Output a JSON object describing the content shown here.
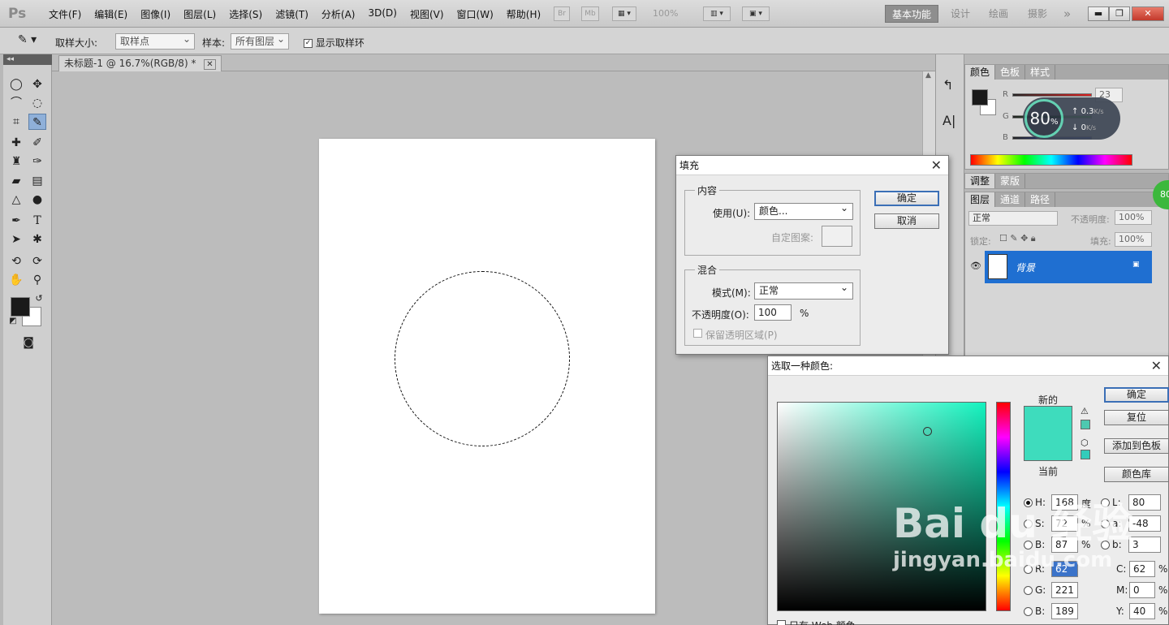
{
  "app": {
    "logo": "Ps",
    "menu": [
      "文件(F)",
      "编辑(E)",
      "图像(I)",
      "图层(L)",
      "选择(S)",
      "滤镜(T)",
      "分析(A)",
      "3D(D)",
      "视图(V)",
      "窗口(W)",
      "帮助(H)"
    ],
    "zoom": "100%",
    "bridge": "Br",
    "minibridge": "Mb",
    "workspaces": [
      "基本功能",
      "设计",
      "绘画",
      "摄影"
    ],
    "more": "»"
  },
  "options_bar": {
    "sample_size_label": "取样大小:",
    "sample_size_value": "取样点",
    "sample_label": "样本:",
    "sample_value": "所有图层",
    "show_ring_label": "显示取样环"
  },
  "document": {
    "tab_title": "未标题-1 @ 16.7%(RGB/8) *"
  },
  "color_panel": {
    "tabs": [
      "颜色",
      "色板",
      "样式"
    ],
    "r_label": "R",
    "g_label": "G",
    "b_label": "B",
    "r_value": "23"
  },
  "net_widget": {
    "percent": "80",
    "percent_sign": "%",
    "up": "0.3",
    "down": "0",
    "unit": "K/s"
  },
  "adjust_panel": {
    "tabs": [
      "调整",
      "蒙版"
    ]
  },
  "layers_panel": {
    "tabs": [
      "图层",
      "通道",
      "路径"
    ],
    "blend_mode": "正常",
    "opacity_label": "不透明度:",
    "opacity_value": "100%",
    "lock_label": "锁定:",
    "fill_label": "填充:",
    "fill_value": "100%",
    "layer_name": "背景"
  },
  "side_badge": "80",
  "fill_dialog": {
    "title": "填充",
    "content_group": "内容",
    "use_label": "使用(U):",
    "use_value": "颜色...",
    "custom_pattern_label": "自定图案:",
    "blend_group": "混合",
    "mode_label": "模式(M):",
    "mode_value": "正常",
    "opacity_label": "不透明度(O):",
    "opacity_value": "100",
    "percent": "%",
    "preserve_label": "保留透明区域(P)",
    "ok": "确定",
    "cancel": "取消"
  },
  "color_picker": {
    "title": "选取一种颜色:",
    "new_label": "新的",
    "current_label": "当前",
    "ok": "确定",
    "reset": "复位",
    "add_swatch": "添加到色板",
    "libraries": "颜色库",
    "fields": {
      "H": "168",
      "S": "72",
      "B": "87",
      "R": "62",
      "G": "221",
      "Bv": "189",
      "L": "80",
      "a": "-48",
      "b": "3",
      "C": "62",
      "M": "0",
      "Y": "40"
    },
    "units": {
      "deg": "度",
      "pct": "%"
    },
    "labels": {
      "H": "H:",
      "S": "S:",
      "B": "B:",
      "R": "R:",
      "G": "G:",
      "Bv": "B:",
      "L": "L:",
      "a": "a:",
      "b": "b:",
      "C": "C:",
      "M": "M:",
      "Y": "Y:"
    },
    "web_only": "只有 Web 颜色",
    "new_color": "#3edcbd"
  },
  "watermark": {
    "main": "Bai du 经验",
    "sub": "jingyan.baidu.com"
  }
}
